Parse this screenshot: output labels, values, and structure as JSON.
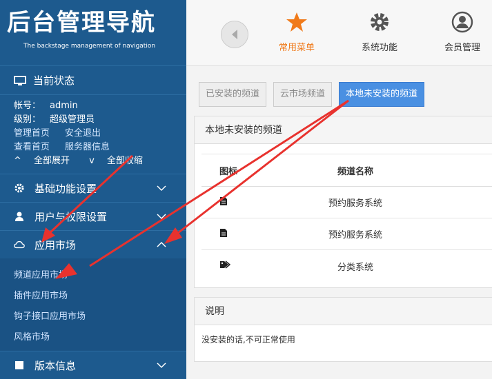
{
  "logo": {
    "title": "后台管理导航",
    "subtitle": "The backstage management of navigation"
  },
  "sidebar": {
    "status_title": "当前状态",
    "account_label": "帐号：",
    "account_value": "admin",
    "level_label": "级别：",
    "level_value": "超级管理员",
    "links": [
      "管理首页",
      "安全退出",
      "查看首页",
      "服务器信息"
    ],
    "expand_all": "全部展开",
    "collapse_all": "全部收缩",
    "menu": [
      {
        "label": "基础功能设置",
        "icon": "gear-icon"
      },
      {
        "label": "用户与权限设置",
        "icon": "user-icon"
      },
      {
        "label": "应用市场",
        "icon": "cloud-icon"
      },
      {
        "label": "版本信息",
        "icon": "book-icon"
      }
    ],
    "submenu": [
      "频道应用市场",
      "插件应用市场",
      "钩子接口应用市场",
      "风格市场"
    ]
  },
  "topbar": {
    "items": [
      {
        "label": "常用菜单",
        "icon": "star-icon",
        "active": true
      },
      {
        "label": "系统功能",
        "icon": "gear-icon"
      },
      {
        "label": "会员管理",
        "icon": "user-circle-icon"
      }
    ]
  },
  "tabs": [
    "已安装的频道",
    "云市场频道",
    "本地未安装的频道"
  ],
  "panel": {
    "title": "本地未安装的频道",
    "col_icon": "图标",
    "col_name": "频道名称",
    "rows": [
      {
        "icon": "document-icon",
        "name": "预约服务系统"
      },
      {
        "icon": "document-icon",
        "name": "预约服务系统"
      },
      {
        "icon": "tags-icon",
        "name": "分类系统"
      }
    ]
  },
  "note": {
    "title": "说明",
    "text": "没安装的话,不可正常使用"
  },
  "colors": {
    "sidebar": "#1d5a8e",
    "accent": "#f07a1a",
    "active_tab": "#4a90e2",
    "arrow": "#e8322e"
  }
}
